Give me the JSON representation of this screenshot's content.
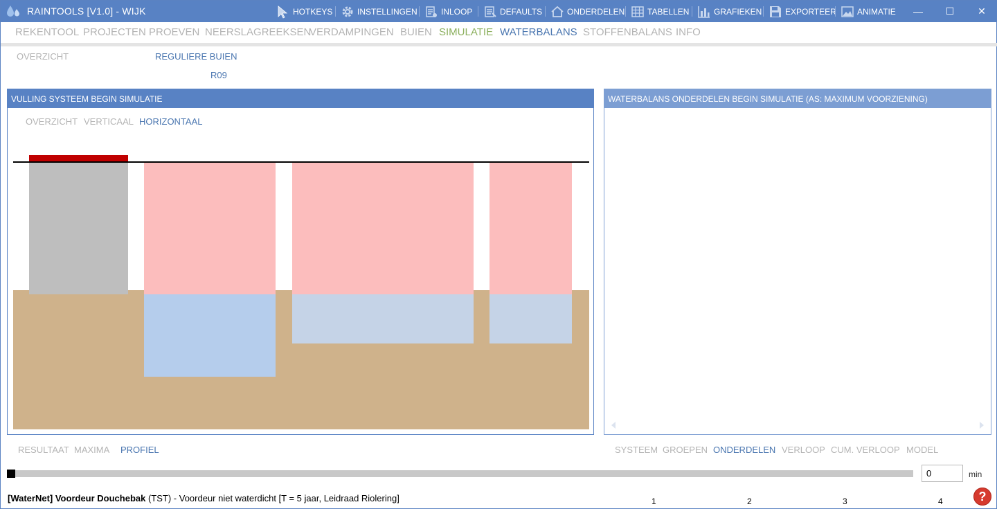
{
  "app": {
    "title": "RAINTOOLS [V1.0] - WIJK"
  },
  "toolbar": [
    {
      "label": "HOTKEYS",
      "icon": "cursor-icon"
    },
    {
      "label": "INSTELLINGEN",
      "icon": "gear-icon"
    },
    {
      "label": "INLOOP",
      "icon": "inloop-icon"
    },
    {
      "label": "DEFAULTS",
      "icon": "defaults-icon"
    },
    {
      "label": "ONDERDELEN",
      "icon": "house-icon"
    },
    {
      "label": "TABELLEN",
      "icon": "table-icon"
    },
    {
      "label": "GRAFIEKEN",
      "icon": "chart-icon"
    },
    {
      "label": "EXPORTEER",
      "icon": "save-icon"
    },
    {
      "label": "ANIMATIE",
      "icon": "image-icon"
    }
  ],
  "window_controls": {
    "minimize": "—",
    "maximize": "☐",
    "close": "✕"
  },
  "nav": [
    {
      "label": "REKENTOOL",
      "state": "inactive"
    },
    {
      "label": "PROJECTEN",
      "state": "inactive"
    },
    {
      "label": "PROEVEN",
      "state": "inactive"
    },
    {
      "label": "NEERSLAGREEKSEN",
      "state": "inactive"
    },
    {
      "label": "VERDAMPINGEN",
      "state": "inactive"
    },
    {
      "label": "BUIEN",
      "state": "inactive"
    },
    {
      "label": "SIMULATIE",
      "state": "highlight"
    },
    {
      "label": "WATERBALANS",
      "state": "active"
    },
    {
      "label": "STOFFENBALANS",
      "state": "inactive"
    },
    {
      "label": "INFO",
      "state": "inactive"
    }
  ],
  "subnav": {
    "overzicht": "OVERZICHT",
    "reguliere_buien": "REGULIERE BUIEN",
    "bui": "R09"
  },
  "left_panel": {
    "header": "VULLING SYSTEEM BEGIN SIMULATIE",
    "tabs": {
      "overzicht": "OVERZICHT",
      "verticaal": "VERTICAAL",
      "horizontaal": "HORIZONTAAL"
    },
    "bottom_tabs": {
      "resultaat": "RESULTAAT",
      "maxima": "MAXIMA",
      "profiel": "PROFIEL"
    }
  },
  "right_panel": {
    "header": "WATERBALANS ONDERDELEN BEGIN SIMULATIE (AS: MAXIMUM VOORZIENING)",
    "bar_labels": [
      "1",
      "2",
      "3",
      "4"
    ],
    "bottom_tabs": {
      "systeem": "SYSTEEM",
      "groepen": "GROEPEN",
      "onderdelen": "ONDERDELEN",
      "verloop": "VERLOOP",
      "cum_verloop": "CUM. VERLOOP",
      "model": "MODEL"
    }
  },
  "time": {
    "value": "0",
    "unit": "min",
    "progress": 0
  },
  "status": {
    "part1": "[WaterNet] Voordeur Douchebak",
    "part2": " (TST) - Voordeur niet waterdicht [T = 5 jaar, Leidraad Riolering]"
  },
  "help": {
    "label": "?"
  },
  "colors": {
    "titlebar": "#5882c4",
    "active_nav": "#4a76b0",
    "highlight_nav": "#8cb05e",
    "inactive_nav": "#b4b4b4",
    "soil": "#cfb28b",
    "pink_storage": "#fcbdbd",
    "water_blue": "#b5cdec",
    "water_grey_blue": "#c5d3e7",
    "roof_grey": "#bebebe",
    "roof_red": "#c00000"
  }
}
